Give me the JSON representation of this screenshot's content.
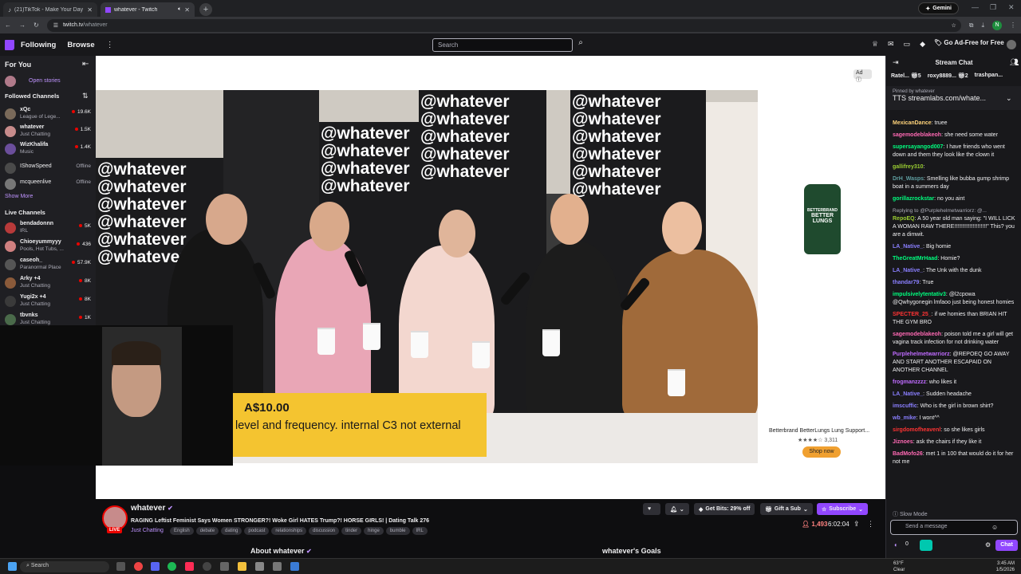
{
  "browser": {
    "tabs": [
      {
        "title": "(21)TikTok - Make Your Day",
        "active": false
      },
      {
        "title": "whatever - Twitch",
        "active": true
      }
    ],
    "gemini_label": "Gemini",
    "url_host": "twitch.tv",
    "url_path": "/whatever",
    "profile_initial": "N"
  },
  "topnav": {
    "following": "Following",
    "browse": "Browse",
    "search_placeholder": "Search",
    "ad_free": "Go Ad-Free for Free"
  },
  "sidebar": {
    "for_you": "For You",
    "open_stories": "Open stories",
    "followed_header": "Followed Channels",
    "followed": [
      {
        "name": "xQc",
        "game": "League of Lege...",
        "viewers": "19.6K",
        "color": "#7a6a5a"
      },
      {
        "name": "whatever",
        "game": "Just Chatting",
        "viewers": "1.5K",
        "color": "#c78b8b"
      },
      {
        "name": "WizKhalifa",
        "game": "Music",
        "viewers": "1.4K",
        "color": "#6b4e9b"
      },
      {
        "name": "IShowSpeed",
        "game": "",
        "viewers": "Offline",
        "color": "#4a4a4a"
      },
      {
        "name": "mcqueenlive",
        "game": "",
        "viewers": "Offline",
        "color": "#777"
      }
    ],
    "show_more": "Show More",
    "live_header": "Live Channels",
    "live": [
      {
        "name": "bendadonnn",
        "game": "IRL",
        "viewers": "5K",
        "color": "#b83a3a"
      },
      {
        "name": "Chioeyummyyy",
        "game": "Pools, Hot Tubs, ...",
        "viewers": "436",
        "color": "#d08080"
      },
      {
        "name": "caseoh_",
        "game": "Paranormal Place",
        "viewers": "57.9K",
        "color": "#555"
      },
      {
        "name": "Arky +4",
        "game": "Just Chatting",
        "viewers": "8K",
        "color": "#8a5a3a"
      },
      {
        "name": "Yugi2x +4",
        "game": "Just Chatting",
        "viewers": "8K",
        "color": "#3a3a3a"
      },
      {
        "name": "tbvnks",
        "game": "Just Chatting",
        "viewers": "1K",
        "color": "#4a6a4a"
      }
    ]
  },
  "video": {
    "wall_text": "@whatever",
    "ad_label": "Ad",
    "ad_product": "Betterbrand BetterLungs Lung Support...",
    "ad_rating": "★★★★☆ 3,311",
    "ad_shop": "Shop now",
    "bottle_brand": "BETTERBRAND",
    "bottle_name": "BETTER LUNGS",
    "sub_amount": "A$10.00",
    "sub_message": "level and frequency. internal C3 not external"
  },
  "stream": {
    "name": "whatever",
    "live": "LIVE",
    "title": "RAGING Leftist Feminist Says Women STRONGER?! Woke Girl HATES Trump?! HORSE GIRLS! | Dating Talk 276",
    "category": "Just Chatting",
    "tags": [
      "English",
      "debate",
      "dating",
      "podcast",
      "relationships",
      "discussion",
      "tinder",
      "hinge",
      "bumble",
      "IRL"
    ],
    "get_bits": "Get Bits: 29% off",
    "gift_sub": "Gift a Sub",
    "subscribe": "Subscribe",
    "viewers": "1,493",
    "uptime": "6:02:04",
    "about": "About whatever",
    "goals": "whatever's Goals"
  },
  "chat": {
    "title": "Stream Chat",
    "gifters": [
      {
        "name": "Ratel...",
        "count": "5"
      },
      {
        "name": "roxy8889...",
        "count": "2"
      },
      {
        "name": "trashpan...",
        "count": ""
      }
    ],
    "pinned_by": "Pinned by whatever",
    "pinned_text": "TTS streamlabs.com/whate...",
    "messages": [
      {
        "user": "MexicanDance",
        "color": "#ffd37a",
        "text": "truee",
        "reply": ""
      },
      {
        "user": "sagemodeblakeoh",
        "color": "#ff69b4",
        "text": "she need some water",
        "reply": ""
      },
      {
        "user": "supersayangod007",
        "color": "#00ff7f",
        "text": "I have friends who went down and them they look like the clown it",
        "reply": ""
      },
      {
        "user": "gallifrey310",
        "color": "#9acd32",
        "text": "",
        "reply": ""
      },
      {
        "user": "DrH_Wasps",
        "color": "#5f9ea0",
        "text": "Smelling like bubba gump shrimp boat in a summers day",
        "reply": ""
      },
      {
        "user": "gorillazrockstar",
        "color": "#00ff7f",
        "text": "no you aint",
        "reply": ""
      },
      {
        "user": "RepoEQ",
        "color": "#9acd32",
        "text": "A 50 year old man saying: \"I WILL LICK A WOMAN RAW THERE!!!!!!!!!!!!!!!!!!!!!\" This? you are a dimwit.",
        "reply": "Replying to @Purplehelmetwarriorz: @..."
      },
      {
        "user": "LA_Native_",
        "color": "#8a7fff",
        "text": "Big homie",
        "reply": ""
      },
      {
        "user": "TheGreatMrHaad",
        "color": "#00ff7f",
        "text": "Homie?",
        "reply": ""
      },
      {
        "user": "LA_Native_",
        "color": "#8a7fff",
        "text": "The Unk with the dunk",
        "reply": ""
      },
      {
        "user": "thandar79",
        "color": "#8a7fff",
        "text": "True",
        "reply": ""
      },
      {
        "user": "impulsivelytentativ3",
        "color": "#00ff7f",
        "text": "@l2cpowa @Qwhygonegin lmfaoo just being honest homies",
        "reply": ""
      },
      {
        "user": "SPECTER_25_",
        "color": "#ff3333",
        "text": "if we homies than BRIAN HIT THE GYM BRO",
        "reply": ""
      },
      {
        "user": "sagemodeblakeoh",
        "color": "#ff69b4",
        "text": "poison told me a girl will get vagina track infection for not drinking water",
        "reply": ""
      },
      {
        "user": "Purplehelmetwarriorz",
        "color": "#bf6bff",
        "text": "@REPOEQ GO AWAY AND START ANOTHER ESCAPAID ON ANOTHER CHANNEL",
        "reply": ""
      },
      {
        "user": "frogmanzzzz",
        "color": "#bf6bff",
        "text": "who likes it",
        "reply": ""
      },
      {
        "user": "LA_Native_",
        "color": "#8a7fff",
        "text": "Sudden headache",
        "reply": ""
      },
      {
        "user": "imscuffic",
        "color": "#8a7fff",
        "text": "Who is the girl in brown shirt?",
        "reply": ""
      },
      {
        "user": "wb_mike",
        "color": "#8a7fff",
        "text": "I wont^^",
        "reply": ""
      },
      {
        "user": "sirgdomofheavenl",
        "color": "#ff3333",
        "text": "so she likes girls",
        "reply": ""
      },
      {
        "user": "Jiznoes",
        "color": "#ff69b4",
        "text": "ask the chairs if they like it",
        "reply": ""
      },
      {
        "user": "BadMofo26",
        "color": "#ff69b4",
        "text": "met 1 in 100 that would do it for her not me",
        "reply": ""
      }
    ],
    "slow_mode": "Slow Mode",
    "input_placeholder": "Send a message",
    "points": "0",
    "chat_button": "Chat"
  },
  "taskbar": {
    "search": "Search",
    "weather_temp": "63°F",
    "weather_desc": "Clear",
    "time": "3:45 AM",
    "date": "1/5/2026"
  }
}
